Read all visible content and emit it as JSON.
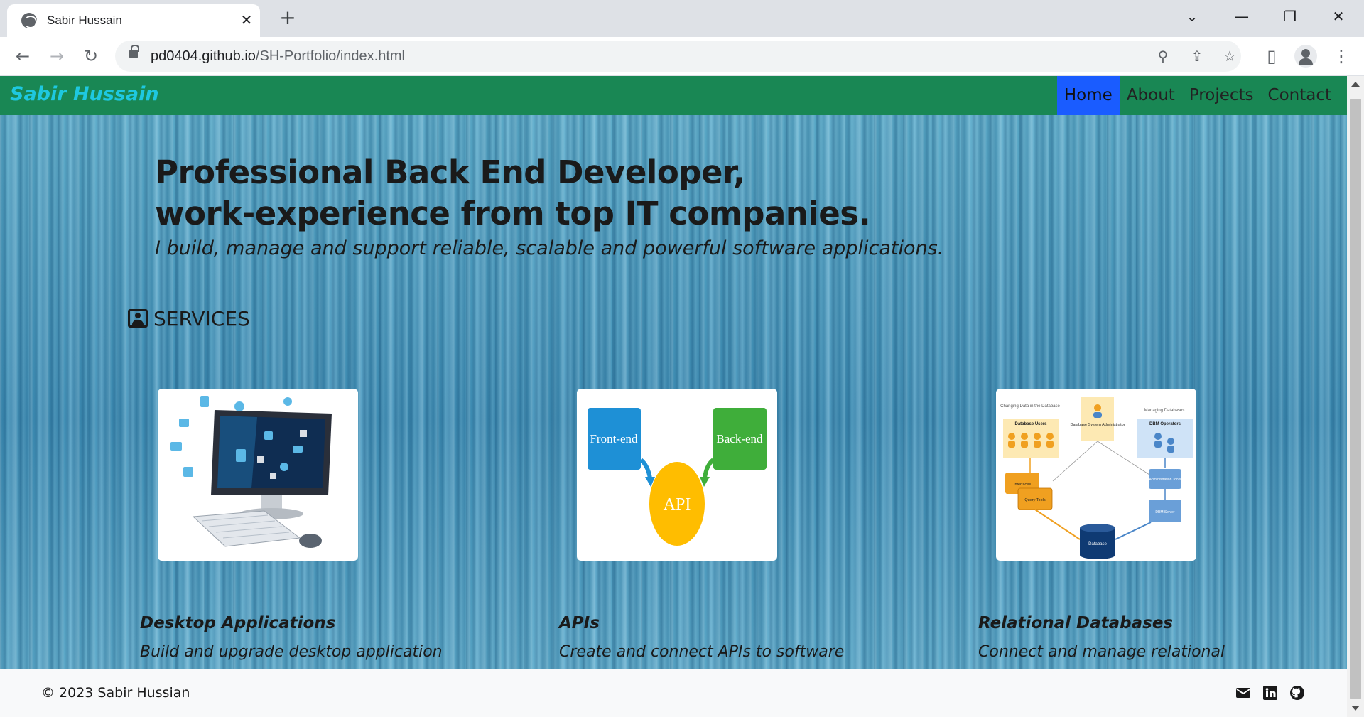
{
  "browser": {
    "tab_title": "Sabir Hussain",
    "url_host": "pd0404.github.io",
    "url_path": "/SH-Portfolio/index.html"
  },
  "navbar": {
    "brand": "Sabir Hussain",
    "links": [
      "Home",
      "About",
      "Projects",
      "Contact"
    ],
    "active": "Home"
  },
  "hero": {
    "headline_line1": "Professional Back End Developer,",
    "headline_line2": "work-experience from top IT companies.",
    "tagline": "I build, manage and support reliable, scalable and powerful software applications."
  },
  "services": {
    "title": "SERVICES",
    "cards": [
      {
        "title": "Desktop Applications",
        "desc": "Build and upgrade desktop application based on Java.",
        "image": "desktop-computer-illustration"
      },
      {
        "title": "APIs",
        "desc": "Create and connect APIs to software application.",
        "image": "api-diagram",
        "diagram": {
          "left": "Front-end",
          "right": "Back-end",
          "center": "API"
        }
      },
      {
        "title": "Relational Databases",
        "desc": "Connect and manage relational databases to application back-end.",
        "image": "dbms-diagram",
        "diagram": {
          "col1_caption": "Changing Data in the Database",
          "col1_header": "Database Users",
          "col2_header": "Database System Administrator",
          "col3_caption": "Managing Databases",
          "col3_header": "DBM Operators",
          "box_interfaces": "Interfaces",
          "box_query": "Query Tools",
          "box_admin": "Administration Tools",
          "box_server": "DBM Server",
          "db_label": "Database"
        }
      }
    ]
  },
  "footer": {
    "copyright": "© 2023 Sabir Hussian",
    "icons": [
      "mail-icon",
      "linkedin-icon",
      "github-icon"
    ]
  },
  "colors": {
    "navbar_bg": "#198754",
    "brand": "#1ec8e0",
    "active_link_bg": "#1a5cff"
  }
}
